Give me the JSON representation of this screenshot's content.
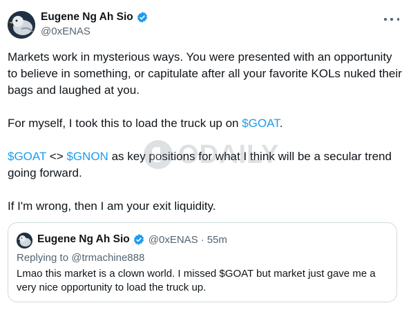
{
  "author": {
    "name": "Eugene Ng Ah Sio",
    "handle": "@0xENAS",
    "verified_icon": "verified-badge-icon",
    "avatar_icon": "bird-avatar-icon"
  },
  "menu": {
    "icon": "more-options-icon"
  },
  "tweet": {
    "p1": "Markets work in mysterious ways. You were presented with an opportunity to believe in something, or capitulate after all your favorite KOLs nuked their bags and laughed at you.",
    "p2_before": "For myself, I took this to load the truck up on ",
    "p2_tag": "$GOAT",
    "p2_after": ".",
    "p3_tag1": "$GOAT",
    "p3_mid": " <> ",
    "p3_tag2": "$GNON",
    "p3_after": " as key positions for what I think will be a secular trend going forward.",
    "p4": "If I'm wrong, then I am your exit liquidity."
  },
  "watermark": {
    "text": "ODAILY"
  },
  "quoted": {
    "name": "Eugene Ng Ah Sio",
    "handle": "@0xENAS",
    "separator": "·",
    "time": "55m",
    "reply": "Replying to @trmachine888",
    "text": "Lmao this market is a clown world. I missed $GOAT but market just gave me a very nice opportunity to load the truck up."
  },
  "colors": {
    "accent": "#1d9bf0",
    "text": "#0f1419",
    "secondary": "#536471",
    "border": "#cfd9de"
  }
}
